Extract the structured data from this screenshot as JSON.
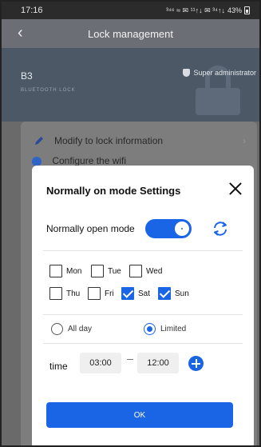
{
  "status_bar": {
    "time": "17:16",
    "indicators": "³⁴⁶ ≈ ✉ ¹¹↑↓ ✉ ³⁴↑↓",
    "battery": "43%"
  },
  "header": {
    "title": "Lock management",
    "back_icon": "chevron-left"
  },
  "lock": {
    "name": "B3",
    "type": "BLUETOOTH LOCK",
    "role": "Super administrator"
  },
  "menu": {
    "item1": "Modify to lock information",
    "item2": "Configure the wifi"
  },
  "modal": {
    "title": "Normally on mode Settings",
    "mode_label": "Normally open mode",
    "mode_enabled": true,
    "days": [
      {
        "label": "Mon",
        "checked": false
      },
      {
        "label": "Tue",
        "checked": false
      },
      {
        "label": "Wed",
        "checked": false
      },
      {
        "label": "Thu",
        "checked": false
      },
      {
        "label": "Fri",
        "checked": false
      },
      {
        "label": "Sat",
        "checked": true
      },
      {
        "label": "Sun",
        "checked": true
      }
    ],
    "radio_all_day": "All day",
    "radio_limited": "Limited",
    "selected_radio": "Limited",
    "time_label": "time",
    "time_start": "03:00",
    "time_end": "12:00",
    "ok_label": "OK"
  },
  "colors": {
    "accent": "#1a64e6",
    "overlay": "#6a6a6a"
  }
}
